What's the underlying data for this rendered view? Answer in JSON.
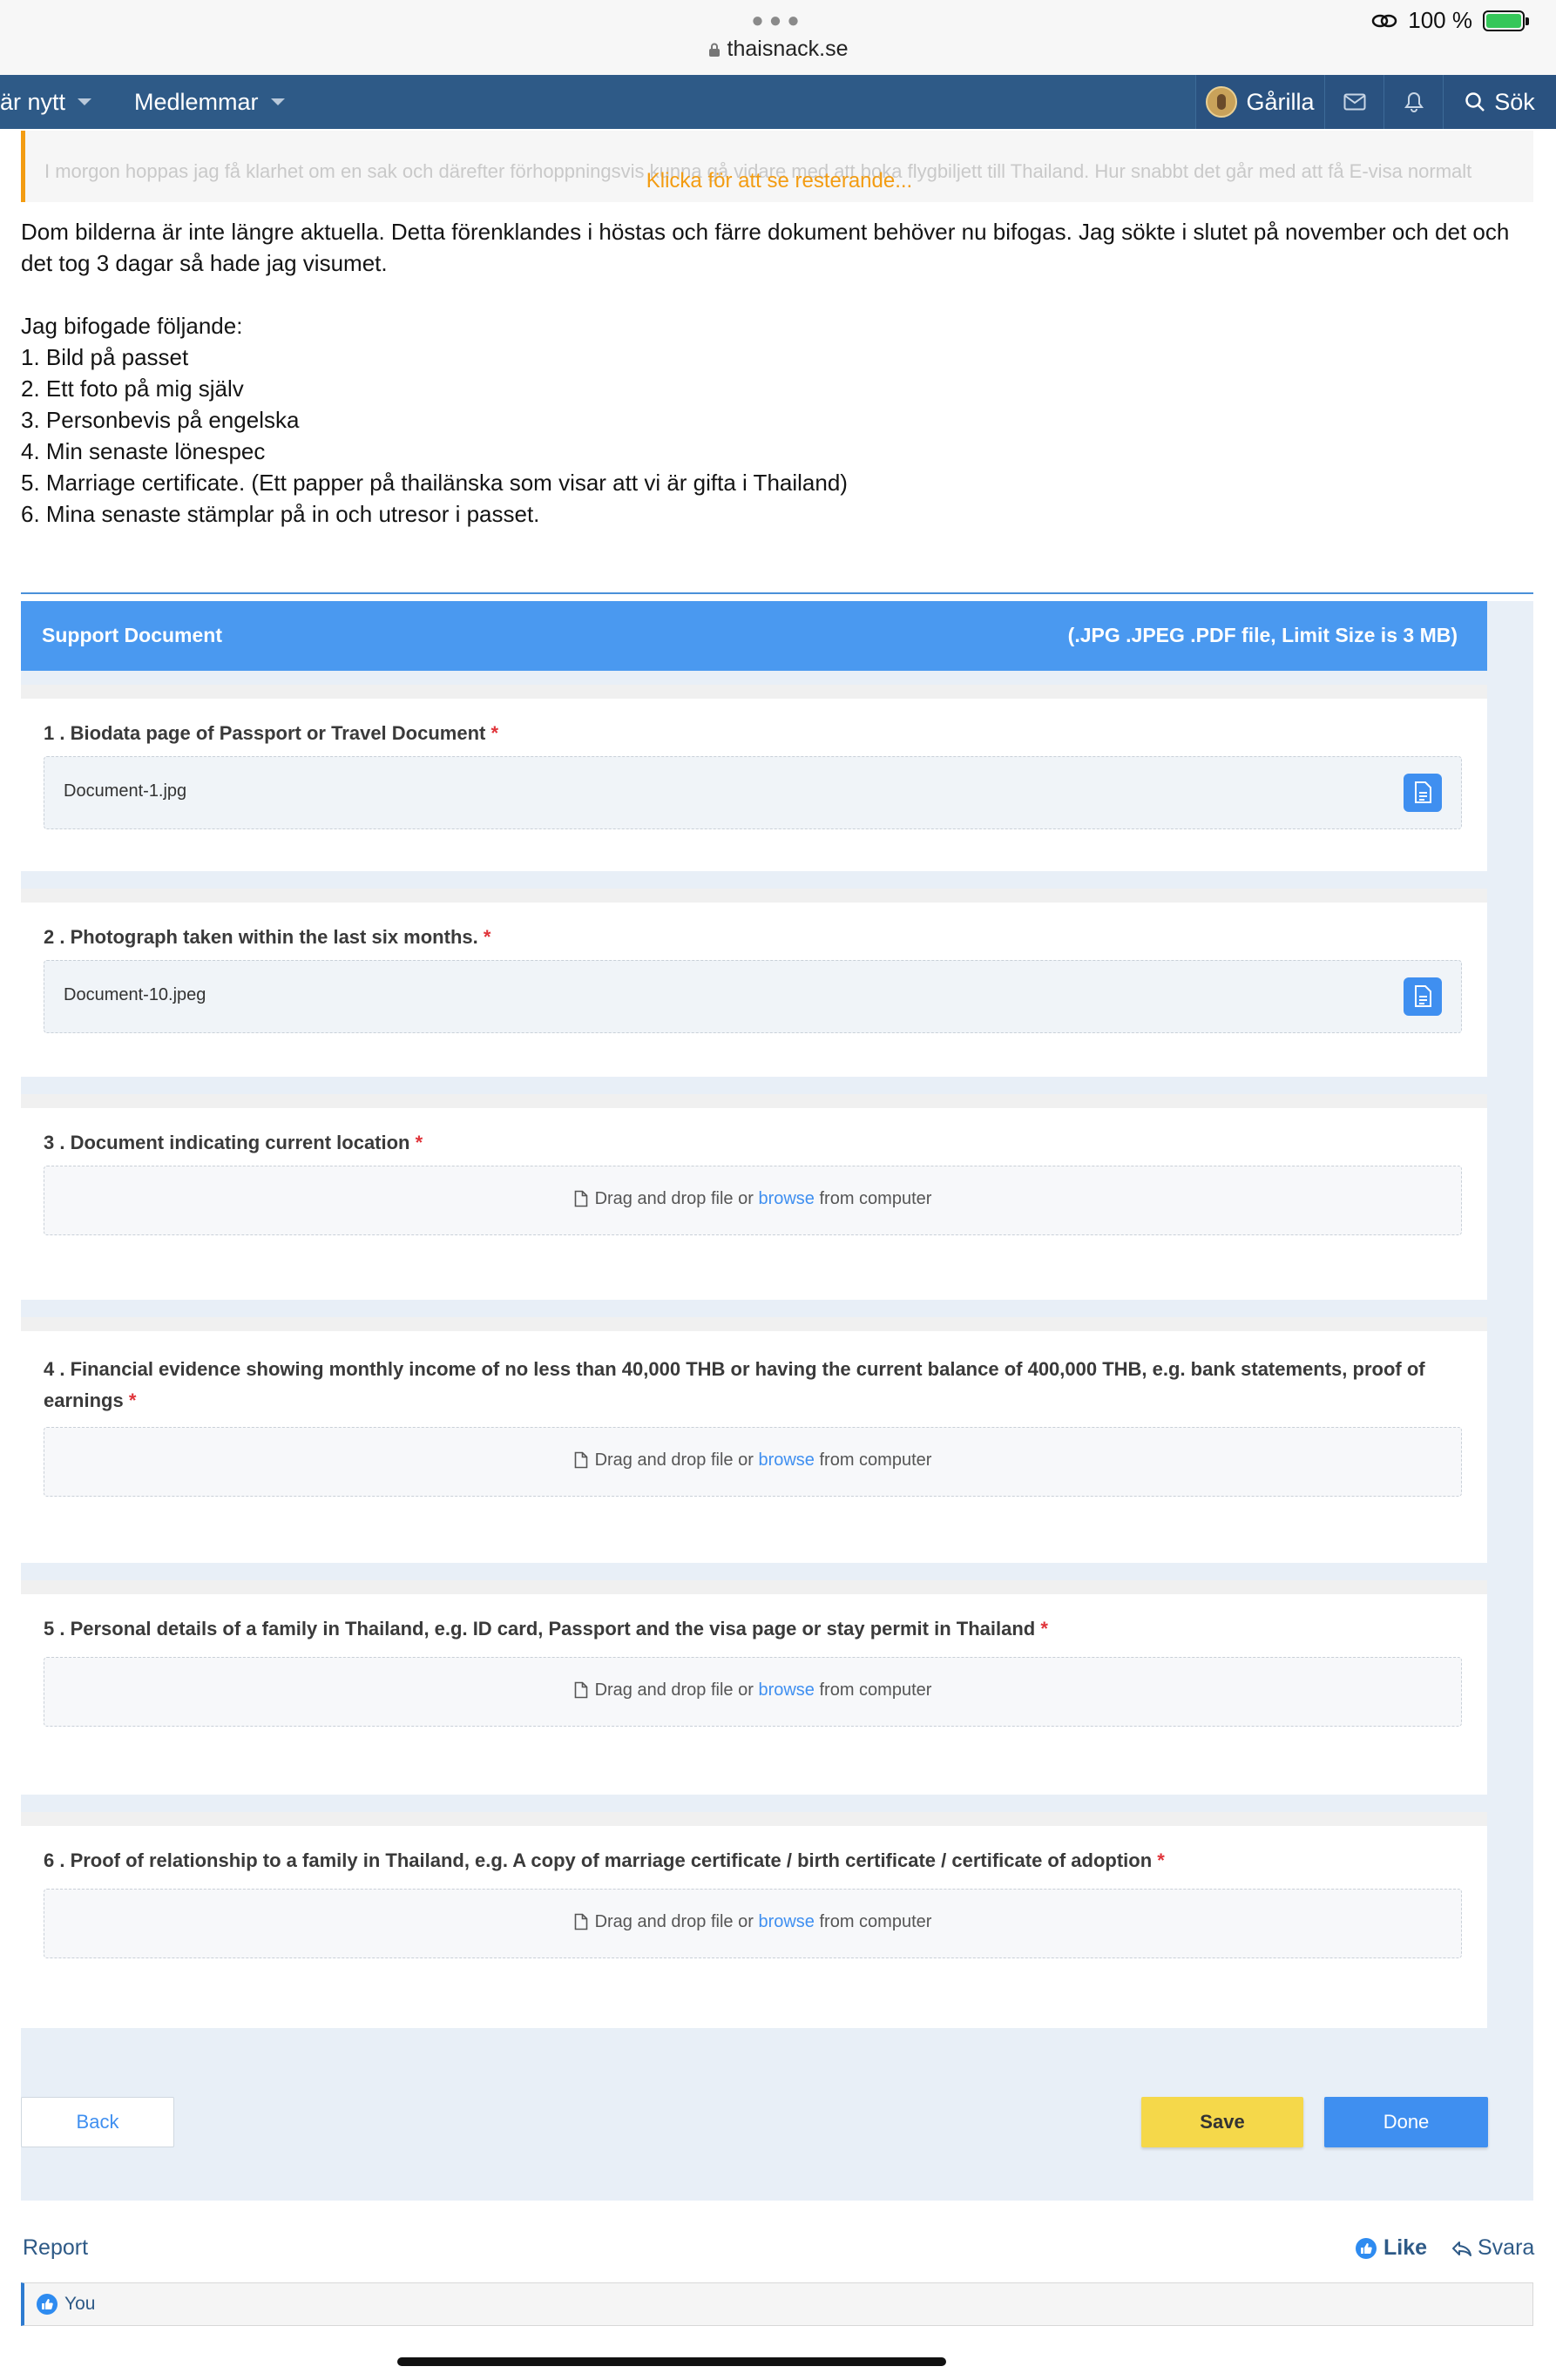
{
  "status_bar": {
    "url": "thaisnack.se",
    "battery": "100 %"
  },
  "nav": {
    "items": [
      {
        "label": "är nytt"
      },
      {
        "label": "Medlemmar"
      }
    ],
    "user": "Gårilla",
    "search": "Sök"
  },
  "quote": {
    "preview": "I morgon hoppas jag få klarhet om en sak och därefter förhoppningsvis kunna gå vidare med att boka flygbiljett till Thailand. Hur snabbt det går med att få E-visa normalt",
    "expand": "Klicka för att se resterande..."
  },
  "post": {
    "line1": "Dom bilderna är inte längre aktuella. Detta förenklandes i höstas och färre dokument behöver nu bifogas. Jag sökte i slutet på november och det och",
    "line2": "det tog 3 dagar så hade jag visumet.",
    "intro": "Jag bifogade följande:",
    "items": [
      "1. Bild på passet",
      "2. Ett foto på mig själv",
      "3. Personbevis på engelska",
      "4. Min senaste lönespec",
      "5. Marriage certificate. (Ett papper på thailänska som visar att vi är gifta i Thailand)",
      "6. Mina senaste stämplar på in och utresor i passet."
    ]
  },
  "support_form": {
    "title": "Support Document",
    "limit": "(.JPG .JPEG .PDF file, Limit Size is 3 MB)",
    "required_mark": "*",
    "drop_prefix": "Drag and drop file or",
    "browse": "browse",
    "drop_suffix": "from computer",
    "questions": [
      {
        "label": "1 . Biodata page of Passport or Travel Document",
        "file": "Document-1.jpg"
      },
      {
        "label": "2 . Photograph taken within the last six months.",
        "file": "Document-10.jpeg"
      },
      {
        "label": "3 . Document indicating current location"
      },
      {
        "label": "4 . Financial evidence showing monthly income of no less than 40,000 THB or having the current balance of 400,000 THB, e.g. bank statements, proof of earnings"
      },
      {
        "label": "5 . Personal details of a family in Thailand, e.g. ID card, Passport and the visa page or stay permit in Thailand"
      },
      {
        "label": "6 . Proof of relationship to a family in Thailand, e.g. A copy of marriage certificate / birth certificate / certificate of adoption"
      }
    ],
    "back": "Back",
    "save": "Save",
    "done": "Done"
  },
  "footer": {
    "report": "Report",
    "like": "Like",
    "reply": "Svara",
    "liked_by": "You"
  },
  "colors": {
    "nav": "#2e5a87",
    "form_header": "#4a99f0",
    "accent": "#3f8ff0",
    "save": "#f5d84a",
    "quote_border": "#f39c12"
  }
}
